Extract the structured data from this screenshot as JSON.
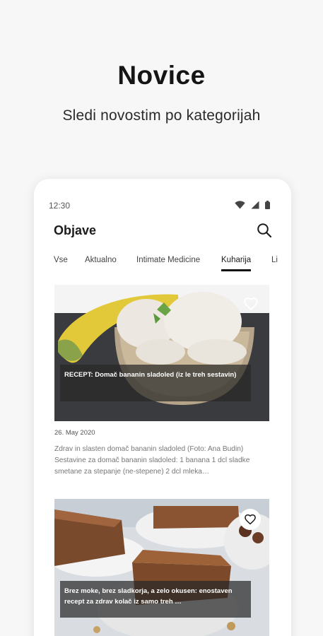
{
  "promo": {
    "title": "Novice",
    "subtitle": "Sledi novostim po kategorijah"
  },
  "status_bar": {
    "time": "12:30",
    "icons": [
      "wifi-icon",
      "signal-icon",
      "battery-icon"
    ]
  },
  "app_bar": {
    "title": "Objave",
    "search_icon": "search-icon"
  },
  "tabs": [
    {
      "label": "Vse",
      "active": false
    },
    {
      "label": "Aktualno",
      "active": false
    },
    {
      "label": "Intimate Medicine",
      "active": false
    },
    {
      "label": "Kuharija",
      "active": true
    },
    {
      "label": "Li",
      "active": false
    }
  ],
  "articles": [
    {
      "title": "RECEPT: Domač bananin sladoled (iz le treh sestavin)",
      "date": "26. May 2020",
      "excerpt": "Zdrav in slasten domač bananin sladoled (Foto: Ana Budin) Sestavine za domač bananin sladoled: 1 banana 1 dcl sladke smetane za stepanje (ne-stepene) 2 dcl mleka…",
      "favorite_icon": "heart-outline-icon"
    },
    {
      "title": "Brez moke, brez sladkorja, a zelo okusen: enostaven recept za zdrav kolač iz samo treh …",
      "favorite_icon": "heart-outline-icon"
    }
  ],
  "colors": {
    "background": "#f7f7f7",
    "card": "#ffffff",
    "text": "#1b1b1b",
    "overlay": "#282828"
  }
}
